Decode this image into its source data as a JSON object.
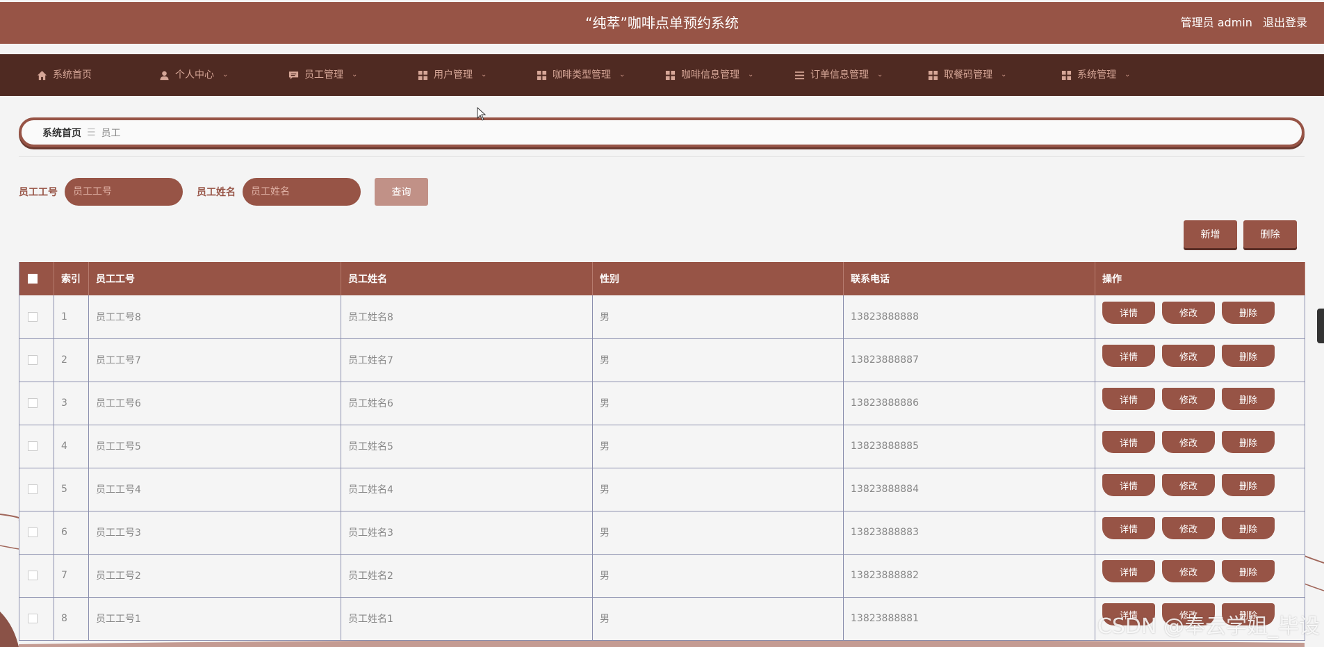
{
  "header": {
    "title": "“纯萃”咖啡点单预约系统",
    "user_role": "管理员 admin",
    "logout": "退出登录"
  },
  "nav": [
    {
      "label": "系统首页",
      "icon": "home-icon",
      "has_dropdown": false
    },
    {
      "label": "个人中心",
      "icon": "user-icon",
      "has_dropdown": true
    },
    {
      "label": "员工管理",
      "icon": "chat-icon",
      "has_dropdown": true
    },
    {
      "label": "用户管理",
      "icon": "grid-icon",
      "has_dropdown": true
    },
    {
      "label": "咖啡类型管理",
      "icon": "grid-icon",
      "has_dropdown": true
    },
    {
      "label": "咖啡信息管理",
      "icon": "grid-icon",
      "has_dropdown": true
    },
    {
      "label": "订单信息管理",
      "icon": "list-icon",
      "has_dropdown": true
    },
    {
      "label": "取餐码管理",
      "icon": "grid-icon",
      "has_dropdown": true
    },
    {
      "label": "系统管理",
      "icon": "grid-icon",
      "has_dropdown": true
    }
  ],
  "breadcrumb": {
    "home": "系统首页",
    "separator": "☰",
    "current": "员工"
  },
  "search": {
    "id_label": "员工工号",
    "id_placeholder": "员工工号",
    "name_label": "员工姓名",
    "name_placeholder": "员工姓名",
    "query_button": "查询"
  },
  "actions": {
    "add": "新增",
    "delete": "删除"
  },
  "table": {
    "columns": [
      "索引",
      "员工工号",
      "员工姓名",
      "性别",
      "联系电话",
      "操作"
    ],
    "row_buttons": {
      "detail": "详情",
      "edit": "修改",
      "delete": "删除"
    },
    "rows": [
      {
        "index": "1",
        "id": "员工工号8",
        "name": "员工姓名8",
        "gender": "男",
        "phone": "13823888888"
      },
      {
        "index": "2",
        "id": "员工工号7",
        "name": "员工姓名7",
        "gender": "男",
        "phone": "13823888887"
      },
      {
        "index": "3",
        "id": "员工工号6",
        "name": "员工姓名6",
        "gender": "男",
        "phone": "13823888886"
      },
      {
        "index": "4",
        "id": "员工工号5",
        "name": "员工姓名5",
        "gender": "男",
        "phone": "13823888885"
      },
      {
        "index": "5",
        "id": "员工工号4",
        "name": "员工姓名4",
        "gender": "男",
        "phone": "13823888884"
      },
      {
        "index": "6",
        "id": "员工工号3",
        "name": "员工姓名3",
        "gender": "男",
        "phone": "13823888883"
      },
      {
        "index": "7",
        "id": "员工工号2",
        "name": "员工姓名2",
        "gender": "男",
        "phone": "13823888882"
      },
      {
        "index": "8",
        "id": "员工工号1",
        "name": "员工姓名1",
        "gender": "男",
        "phone": "13823888881"
      }
    ]
  },
  "watermark": "CSDN @奉云学姐_毕设",
  "colors": {
    "primary": "#975446",
    "nav_bg": "#4f2a22",
    "nav_text": "#d6a697",
    "query_button": "#c19187",
    "page_bg": "#f4f4f4"
  }
}
